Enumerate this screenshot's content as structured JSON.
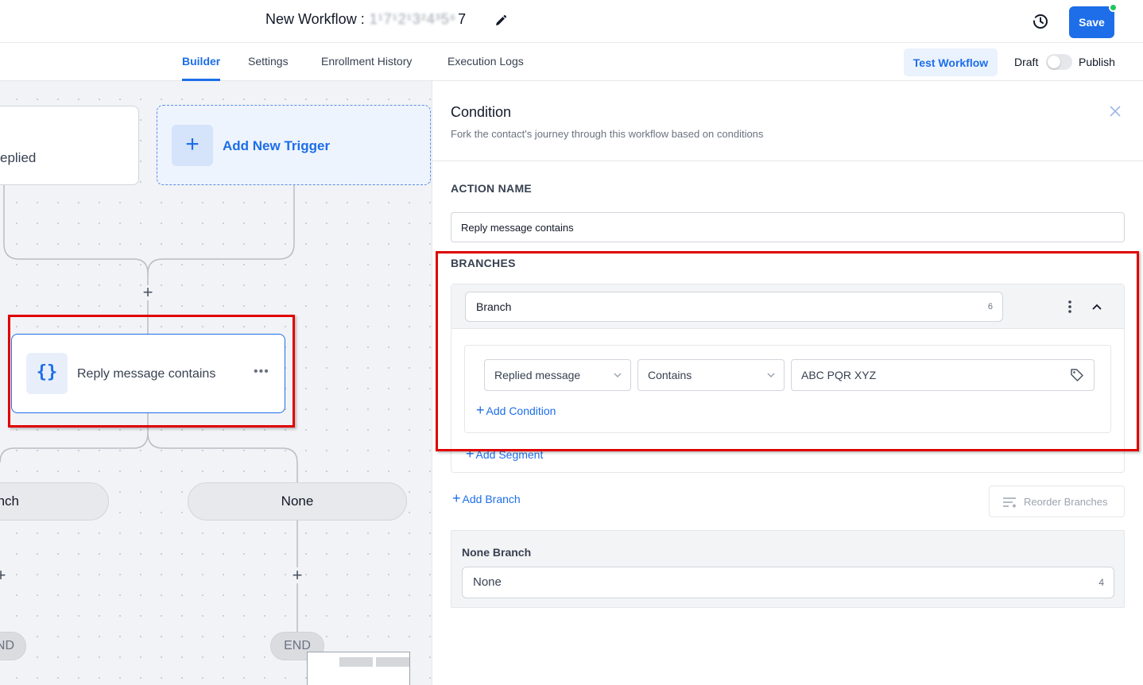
{
  "header": {
    "title_prefix": "New Workflow : ",
    "title_id_masked": "1¹7¹2¹3²4³5⁶",
    "title_id_suffix": "7",
    "save_label": "Save",
    "save_color": "#1d6ee8",
    "status_dot_color": "#22c55e"
  },
  "tabs": [
    {
      "label": "Builder",
      "active": true
    },
    {
      "label": "Settings",
      "active": false
    },
    {
      "label": "Enrollment History",
      "active": false
    },
    {
      "label": "Execution Logs",
      "active": false
    }
  ],
  "toolbar": {
    "test_label": "Test Workflow",
    "draft_label": "Draft",
    "publish_label": "Publish",
    "published": false
  },
  "canvas": {
    "trigger_partial_text": "eplied",
    "add_trigger_label": "Add New Trigger",
    "action_node": {
      "icon": "{}",
      "label": "Reply message contains"
    },
    "branch_left_partial": "nch",
    "branch_right": "None",
    "end_left_partial": "ND",
    "end_right": "END"
  },
  "panel": {
    "title": "Condition",
    "subtitle": "Fork the contact's journey through this workflow based on conditions",
    "action_name_label": "ACTION NAME",
    "action_name_value": "Reply message contains",
    "branches_label": "BRANCHES",
    "branch": {
      "name": "Branch",
      "count": "6",
      "condition": {
        "field": "Replied message",
        "operator": "Contains",
        "value": "ABC PQR XYZ"
      },
      "add_condition_label": "Add Condition",
      "add_segment_label": "Add Segment"
    },
    "add_branch_label": "Add Branch",
    "reorder_label": "Reorder Branches",
    "none_branch": {
      "label": "None Branch",
      "name": "None",
      "count": "4"
    }
  },
  "colors": {
    "accent": "#1d6ee8",
    "highlight": "#e00000"
  }
}
